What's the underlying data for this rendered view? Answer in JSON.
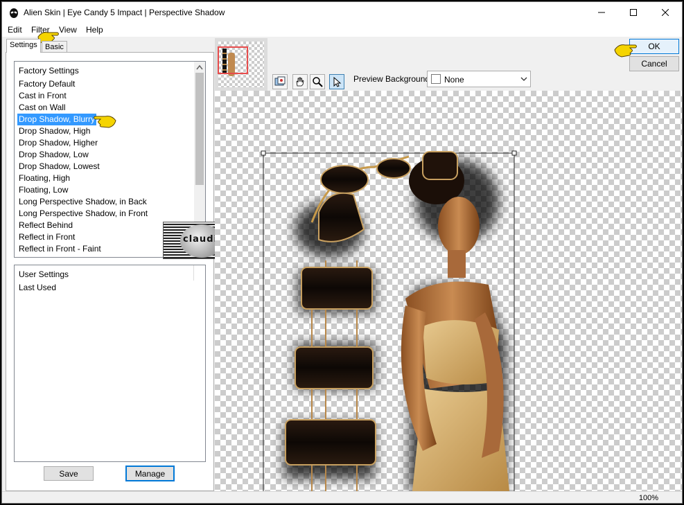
{
  "window": {
    "title": "Alien Skin | Eye Candy 5 Impact | Perspective Shadow",
    "minimize_icon": "minimize-icon",
    "maximize_icon": "maximize-icon",
    "close_icon": "close-icon"
  },
  "menu": [
    "Edit",
    "Filter",
    "View",
    "Help"
  ],
  "tabs": {
    "settings": "Settings",
    "basic": "Basic"
  },
  "factory_settings": {
    "header": "Factory Settings",
    "items": [
      "Factory Default",
      "Cast in Front",
      "Cast on Wall",
      "Drop Shadow, Blurry",
      "Drop Shadow, High",
      "Drop Shadow, Higher",
      "Drop Shadow, Low",
      "Drop Shadow, Lowest",
      "Floating, High",
      "Floating, Low",
      "Long Perspective Shadow, in Back",
      "Long Perspective Shadow, in Front",
      "Reflect Behind",
      "Reflect in Front",
      "Reflect in Front - Faint"
    ],
    "selected": "Drop Shadow, Blurry"
  },
  "user_settings": {
    "header": "User Settings",
    "items": [
      "Last Used"
    ]
  },
  "buttons": {
    "save": "Save",
    "manage": "Manage",
    "ok": "OK",
    "cancel": "Cancel"
  },
  "toolbar": {
    "tools": [
      "preview-toggle-icon",
      "hand-icon",
      "zoom-icon",
      "arrow-icon"
    ],
    "active_tool": "arrow-icon",
    "preview_bg_label": "Preview Background:",
    "preview_bg_value": "None"
  },
  "watermark": {
    "text": "claudia"
  },
  "status": {
    "zoom": "100%"
  },
  "colors": {
    "selection": "#3399ff",
    "accent": "#0078d7",
    "pointer_hand": "#f5d400"
  }
}
